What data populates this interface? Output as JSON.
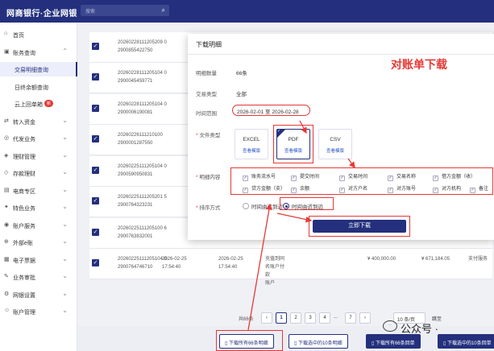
{
  "header": {
    "logo": "网商银行·企业网银",
    "search_placeholder": "搜索"
  },
  "sidebar": {
    "items": [
      {
        "icon": "⌂",
        "label": "首页",
        "chev": ""
      },
      {
        "icon": "▣",
        "label": "账务查询",
        "chev": "⌃"
      },
      {
        "icon": "",
        "label": "交易明细查询",
        "chev": "",
        "sub": true,
        "active": true
      },
      {
        "icon": "",
        "label": "日终余额查询",
        "chev": "",
        "sub": true
      },
      {
        "icon": "",
        "label": "云上回单箱",
        "chev": "",
        "sub": true,
        "badge": "新"
      },
      {
        "icon": "⇄",
        "label": "转入资金",
        "chev": "⌄"
      },
      {
        "icon": "◎",
        "label": "代发业务",
        "chev": "⌄"
      },
      {
        "icon": "◈",
        "label": "理财管理",
        "chev": "⌄"
      },
      {
        "icon": "◇",
        "label": "存款理财",
        "chev": "⌄"
      },
      {
        "icon": "▤",
        "label": "电商专区",
        "chev": "⌄"
      },
      {
        "icon": "✦",
        "label": "特色业务",
        "chev": "⌄"
      },
      {
        "icon": "◉",
        "label": "账户服务",
        "chev": "⌄"
      },
      {
        "icon": "⊕",
        "label": "外部e账",
        "chev": "⌄"
      },
      {
        "icon": "▦",
        "label": "电子票据",
        "chev": "⌄"
      },
      {
        "icon": "✎",
        "label": "业务审批",
        "chev": "⌄"
      },
      {
        "icon": "⚙",
        "label": "网银设置",
        "chev": "⌄"
      },
      {
        "icon": "☺",
        "label": "账户管理",
        "chev": "⌄"
      }
    ]
  },
  "table": {
    "rows": [
      {
        "id": "20260228111205209 0\n2900855422750",
        "right": "四分什-拨\n"
      },
      {
        "id": "20260228111205104 0\n2900045459771",
        "right": ""
      },
      {
        "id": "20260228111205104 0\n2900006190081",
        "right": ""
      },
      {
        "id": "20260226111210100\n2900001287550",
        "right": ""
      },
      {
        "id": "20260225111205104 0\n2900590950831",
        "right": ""
      },
      {
        "id": "20260225111205201 5\n2900764323231",
        "right": ""
      },
      {
        "id": "20260225111205100 6\n2900763832001",
        "right": ""
      },
      {
        "id": "20260225111205104 0\n2900764746710",
        "col2": "2026-02-25\n17:54:40",
        "col3": "2026-02-25\n17:54:40",
        "col4": "充值到同\n名账户付\n款\n账户",
        "amount": "¥ 400,000.00",
        "balance": "¥ 671,184.05",
        "type": "支付服务"
      }
    ]
  },
  "pager": {
    "total": "共66条",
    "pages": [
      "1",
      "2",
      "3",
      "4",
      "5"
    ],
    "last": "7",
    "ellipsis": "...",
    "size": "10 条/页",
    "jump": "跳至"
  },
  "bottom": {
    "btn1": "下载所有66条明细",
    "btn2": "下载选中的10条明细",
    "btn3": "下载所有66条回单",
    "btn4": "下载选中的10条回单"
  },
  "modal": {
    "title": "下载明细",
    "count_label": "明细数量",
    "count": "66条",
    "type_label": "交易类型",
    "type": "全部",
    "range_label": "时间范围",
    "range": "2026-02-01 至 2026-02-28",
    "format_label": "文件类型",
    "formats": [
      {
        "name": "EXCEL",
        "preview": "查看模版"
      },
      {
        "name": "PDF",
        "preview": "查看模版",
        "selected": true
      },
      {
        "name": "CSV",
        "preview": "查看模版"
      }
    ],
    "fields_label": "明细内容",
    "fields": [
      [
        "账务流水号",
        "提交时间",
        "交易时间",
        "交易名称",
        "借方金额（收）"
      ],
      [
        "贷方金额（支）",
        "余额",
        "对方户名",
        "对方账号",
        "对方机构",
        "备注"
      ]
    ],
    "sort_label": "排序方式",
    "sort_options": [
      "时间由远到近",
      "时间由近到远"
    ],
    "download": "立即下载"
  },
  "annotation": "对账单下载",
  "watermark": "公众号 ·"
}
